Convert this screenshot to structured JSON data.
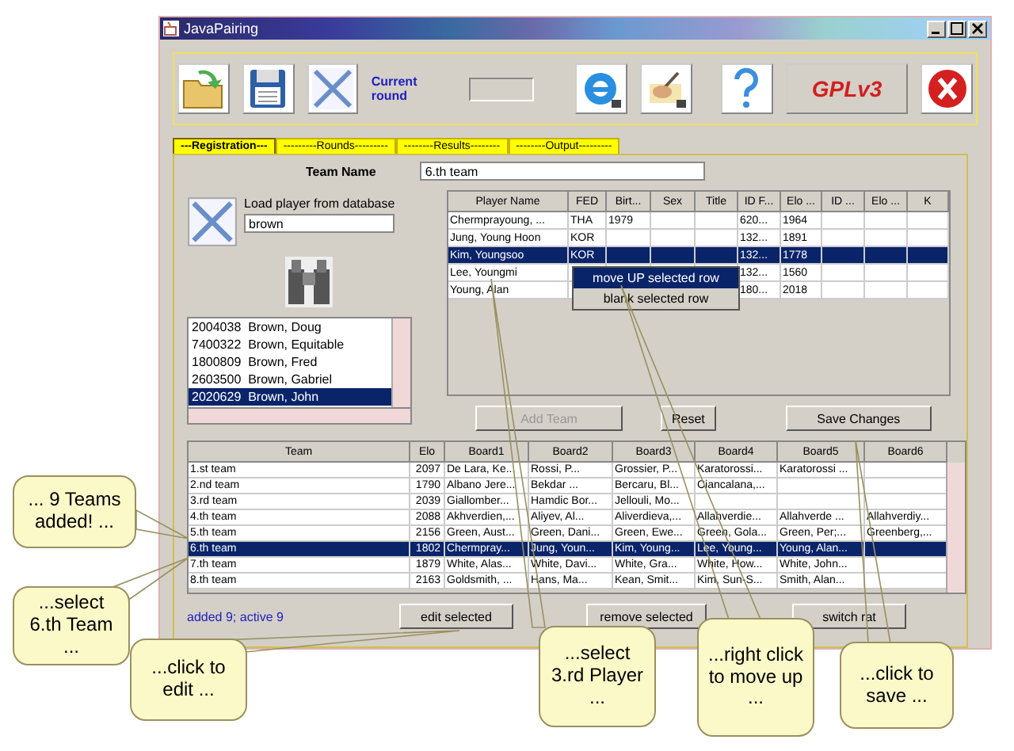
{
  "window": {
    "title": "JavaPairing"
  },
  "toolbar": {
    "current_round_label": "Current round",
    "license_logo": "GPLv3"
  },
  "tabs": [
    {
      "label": "---Registration---",
      "selected": true
    },
    {
      "label": "---------Rounds---------",
      "selected": false
    },
    {
      "label": "--------Results--------",
      "selected": false
    },
    {
      "label": "--------Output---------",
      "selected": false
    }
  ],
  "team_name": {
    "label": "Team Name",
    "value": "6.th team"
  },
  "database": {
    "label": "Load player from database",
    "search": "brown",
    "results": [
      {
        "id": "2004038",
        "name": "Brown, Doug",
        "selected": false
      },
      {
        "id": "7400322",
        "name": "Brown, Equitable",
        "selected": false
      },
      {
        "id": "1800809",
        "name": "Brown, Fred",
        "selected": false
      },
      {
        "id": "2603500",
        "name": "Brown, Gabriel",
        "selected": false
      },
      {
        "id": "2020629",
        "name": "Brown, John",
        "selected": true
      }
    ]
  },
  "players_table": {
    "columns": [
      "Player Name",
      "FED",
      "Birt...",
      "Sex",
      "Title",
      "ID F...",
      "Elo ...",
      "ID ...",
      "Elo ...",
      "K"
    ],
    "rows": [
      {
        "cells": [
          "Chermprayoung, ...",
          "THA",
          "1979",
          null,
          null,
          "620...",
          "1964",
          null,
          null,
          null
        ],
        "selected": false
      },
      {
        "cells": [
          "Jung, Young Hoon",
          "KOR",
          null,
          null,
          null,
          "132...",
          "1891",
          null,
          null,
          null
        ],
        "selected": false
      },
      {
        "cells": [
          "Kim, Youngsoo",
          "KOR",
          null,
          null,
          null,
          "132...",
          "1778",
          null,
          null,
          null
        ],
        "selected": true
      },
      {
        "cells": [
          "Lee, Youngmi",
          null,
          null,
          null,
          null,
          "132...",
          "1560",
          null,
          null,
          null
        ],
        "selected": false
      },
      {
        "cells": [
          "Young, Alan",
          null,
          null,
          null,
          null,
          "180...",
          "2018",
          null,
          null,
          null
        ],
        "selected": false
      }
    ]
  },
  "context_menu": {
    "items": [
      {
        "label": "move UP selected row",
        "selected": true
      },
      {
        "label": "blank selected row",
        "selected": false
      }
    ]
  },
  "buttons": [
    {
      "label": "Add Team",
      "disabled": true
    },
    {
      "label": "Reset",
      "disabled": false
    },
    {
      "label": "Save Changes",
      "disabled": false
    }
  ],
  "teams_table": {
    "columns": [
      "Team",
      "Elo",
      "Board1",
      "Board2",
      "Board3",
      "Board4",
      "Board5",
      "Board6"
    ],
    "rows": [
      {
        "cells": [
          "1.st team",
          "2097",
          "De Lara, Ke...",
          "Rossi, P...",
          "Grossier, P...",
          "Karatorossi...",
          "Karatorossi ...",
          null
        ],
        "selected": false
      },
      {
        "cells": [
          "2.nd team",
          "1790",
          "Albano Jere...",
          "Bekdar ...",
          "Bercaru, Bl...",
          "Ciancalana,...",
          null,
          null
        ],
        "selected": false
      },
      {
        "cells": [
          "3.rd team",
          "2039",
          "Giallomber...",
          "Hamdic Bor...",
          "Jellouli, Mo...",
          null,
          null,
          null
        ],
        "selected": false
      },
      {
        "cells": [
          "4.th team",
          "2088",
          "Akhverdien,...",
          "Aliyev, Al...",
          "Aliverdieva,...",
          "Allahverdie...",
          "Allahverde ...",
          "Allahverdiy..."
        ],
        "selected": false
      },
      {
        "cells": [
          "5.th team",
          "2156",
          "Green, Aust...",
          "Green, Dani...",
          "Green, Ewe...",
          "Green, Gola...",
          "Green, Per;...",
          "Greenberg,..."
        ],
        "selected": false
      },
      {
        "cells": [
          "6.th team",
          "1802",
          "Chermpray...",
          "Jung, Youn...",
          "Kim, Young...",
          "Lee, Young...",
          "Young, Alan...",
          null
        ],
        "selected": true
      },
      {
        "cells": [
          "7.th team",
          "1879",
          "White, Alas...",
          "White, Davi...",
          "White, Gra...",
          "White, How...",
          "White, John...",
          null
        ],
        "selected": false
      },
      {
        "cells": [
          "8.th team",
          "2163",
          "Goldsmith, ...",
          "Hans, Ma...",
          "Kean, Smit...",
          "Kim, Sun-S...",
          "Smith, Alan...",
          null
        ],
        "selected": false
      }
    ]
  },
  "status": "added 9; active 9",
  "bottom_buttons": [
    "edit selected",
    "remove selected",
    "switch rat"
  ],
  "callouts": [
    {
      "text": "... 9 Teams added! ..."
    },
    {
      "text": "...select 6.th Team ..."
    },
    {
      "text": "...click to edit ..."
    },
    {
      "text": "...select 3.rd Player ..."
    },
    {
      "text": "...right click to move up ..."
    },
    {
      "text": "...click to save ..."
    }
  ]
}
